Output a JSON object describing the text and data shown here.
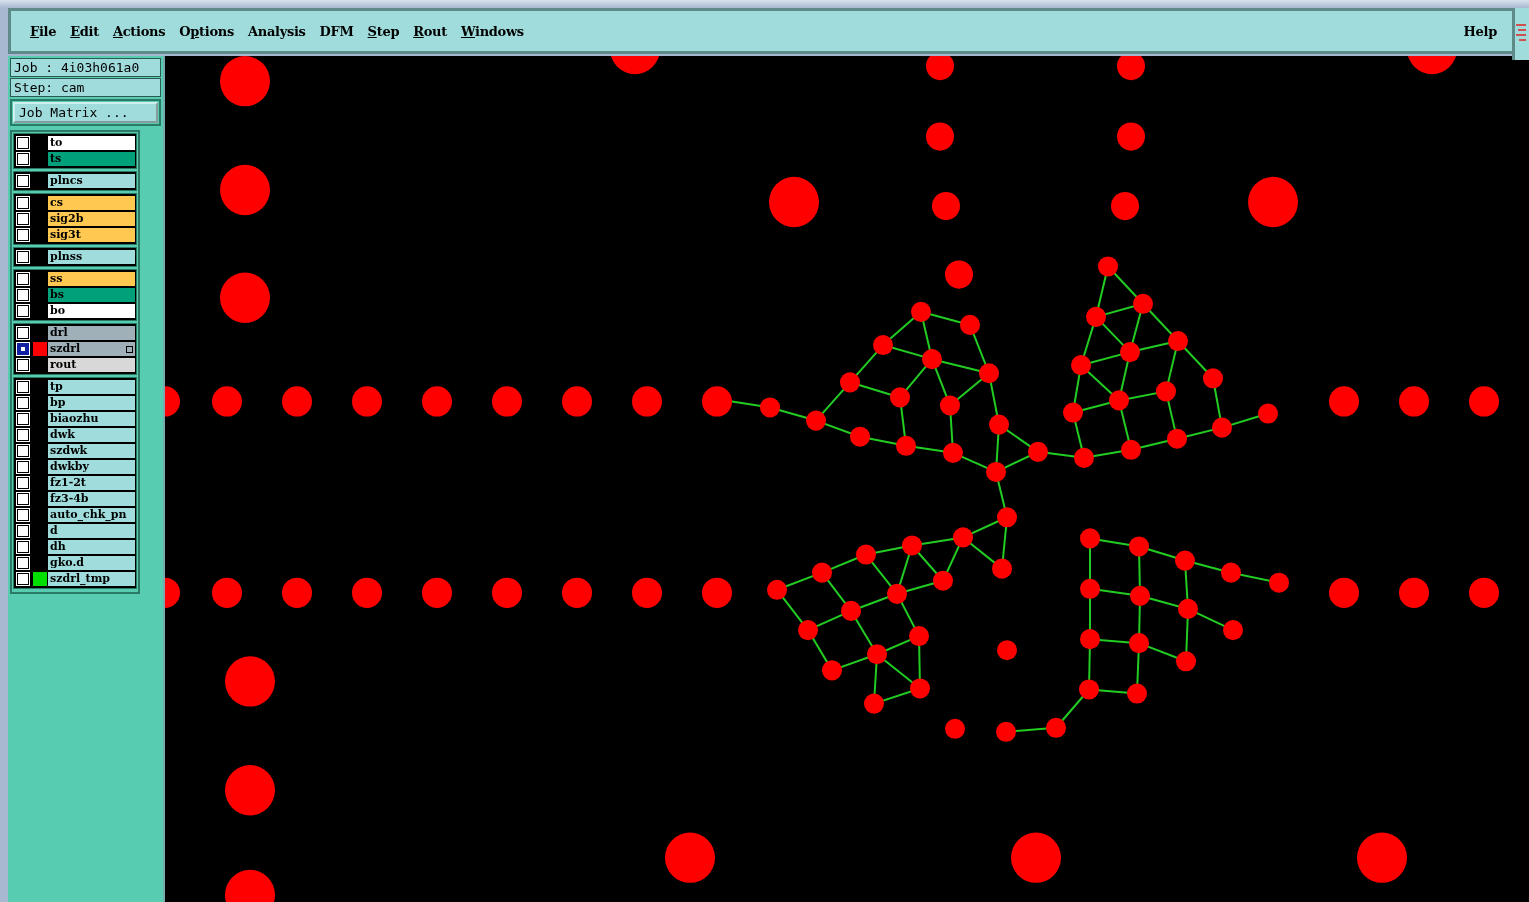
{
  "menu": [
    {
      "key": "F",
      "post": "ile"
    },
    {
      "key": "E",
      "post": "dit"
    },
    {
      "key": "A",
      "post": "ctions"
    },
    {
      "pre": "O",
      "key": "p",
      "post": "tions"
    },
    {
      "pre": "Analysis"
    },
    {
      "pre": "DFM"
    },
    {
      "key": "S",
      "post": "tep"
    },
    {
      "key": "R",
      "post": "out"
    },
    {
      "key": "W",
      "post": "indows"
    }
  ],
  "help": "Help",
  "job": "Job : 4i03h061a0",
  "step": "Step: cam",
  "job_matrix_button": "Job Matrix ...",
  "layer_groups": [
    [
      {
        "name": "to",
        "color": "#ffffff",
        "selected": false
      },
      {
        "name": "ts",
        "color": "#00a07a",
        "selected": false
      }
    ],
    [
      {
        "name": "plncs",
        "color": "#a0dcdc",
        "selected": false
      }
    ],
    [
      {
        "name": "cs",
        "color": "#ffc850",
        "selected": false
      },
      {
        "name": "sig2b",
        "color": "#ffc850",
        "selected": false
      },
      {
        "name": "sig3t",
        "color": "#ffc850",
        "selected": false
      }
    ],
    [
      {
        "name": "plnss",
        "color": "#a0dcdc",
        "selected": false
      }
    ],
    [
      {
        "name": "ss",
        "color": "#ffc850",
        "selected": false
      },
      {
        "name": "bs",
        "color": "#00a07a",
        "selected": false
      },
      {
        "name": "bo",
        "color": "#ffffff",
        "selected": false
      }
    ],
    [
      {
        "name": "drl",
        "color": "#9fb0b8",
        "selected": false
      },
      {
        "name": "szdrl",
        "color": "#9fb0b8",
        "selected": true,
        "swatch": {
          "color": "#ff0000"
        }
      },
      {
        "name": "rout",
        "color": "#d8d8d8",
        "selected": false
      }
    ],
    [
      {
        "name": "tp",
        "color": "#a0dcdc",
        "selected": false
      },
      {
        "name": "bp",
        "color": "#a0dcdc",
        "selected": false
      },
      {
        "name": "biaozhu",
        "color": "#a0dcdc",
        "selected": false
      },
      {
        "name": "dwk",
        "color": "#a0dcdc",
        "selected": false
      },
      {
        "name": "szdwk",
        "color": "#a0dcdc",
        "selected": false
      },
      {
        "name": "dwkby",
        "color": "#a0dcdc",
        "selected": false
      },
      {
        "name": "fz1-2t",
        "color": "#a0dcdc",
        "selected": false
      },
      {
        "name": "fz3-4b",
        "color": "#a0dcdc",
        "selected": false
      },
      {
        "name": "auto_chk_pn",
        "color": "#a0dcdc",
        "selected": false
      },
      {
        "name": "d",
        "color": "#a0dcdc",
        "selected": false
      },
      {
        "name": "dh",
        "color": "#a0dcdc",
        "selected": false
      },
      {
        "name": "gko.d",
        "color": "#a0dcdc",
        "selected": false
      },
      {
        "name": "szdrl_tmp",
        "color": "#a0dcdc",
        "selected": false,
        "swatch": {
          "color": "#00e000"
        }
      }
    ]
  ]
}
